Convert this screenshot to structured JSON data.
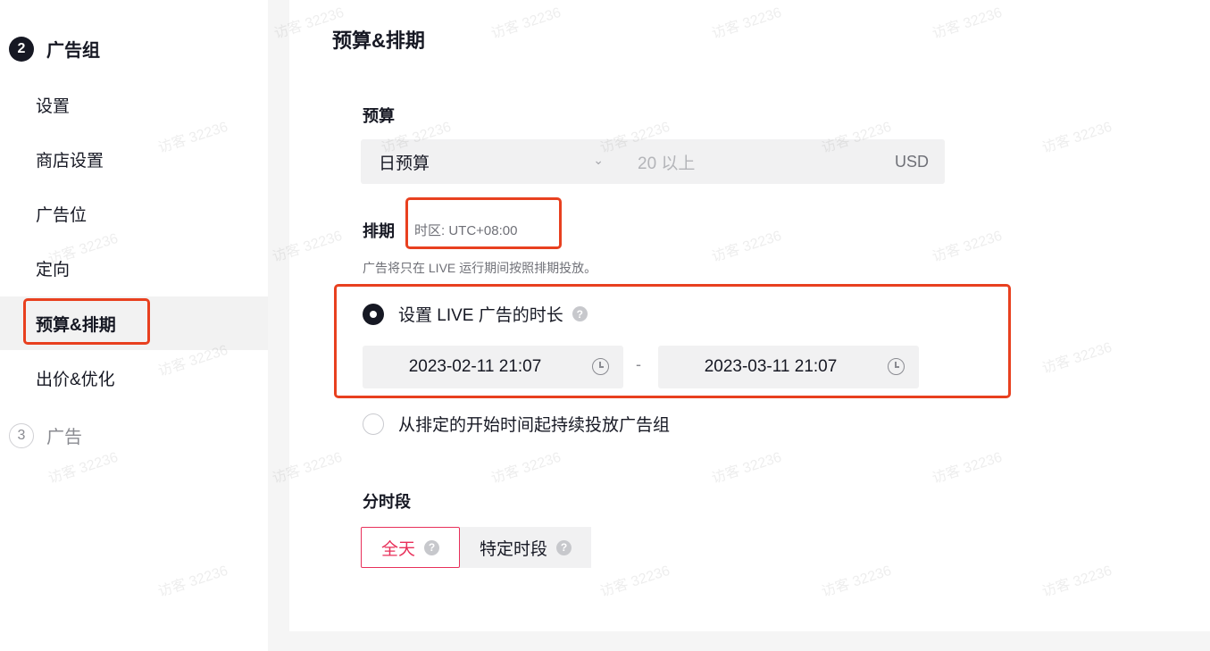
{
  "sidebar": {
    "step2": {
      "number": "2",
      "label": "广告组"
    },
    "items": [
      {
        "label": "设置"
      },
      {
        "label": "商店设置"
      },
      {
        "label": "广告位"
      },
      {
        "label": "定向"
      },
      {
        "label": "预算&排期"
      },
      {
        "label": "出价&优化"
      }
    ],
    "step3": {
      "number": "3",
      "label": "广告"
    }
  },
  "main": {
    "title": "预算&排期",
    "budget": {
      "label": "预算",
      "type": "日预算",
      "amount_placeholder": "20 以上",
      "currency": "USD"
    },
    "schedule": {
      "label": "排期",
      "timezone": "时区: UTC+08:00",
      "hint": "广告将只在 LIVE 运行期间按照排期投放。",
      "option_duration": "设置 LIVE 广告的时长",
      "start": "2023-02-11 21:07",
      "separator": "-",
      "end": "2023-03-11 21:07",
      "option_continuous": "从排定的开始时间起持续投放广告组"
    },
    "dayparting": {
      "label": "分时段",
      "all_day": "全天",
      "specific": "特定时段"
    }
  },
  "watermark": {
    "text": "访客 32236"
  },
  "colors": {
    "highlight": "#e8401f",
    "accent": "#e8305a"
  }
}
